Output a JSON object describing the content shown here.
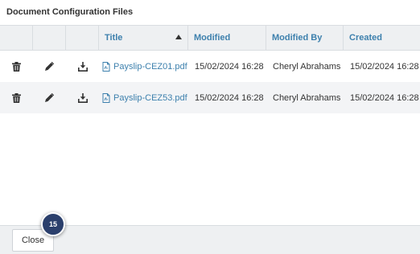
{
  "dialog": {
    "title": "Document Configuration Files",
    "close_label": "Close",
    "step_badge": "15"
  },
  "table": {
    "columns": [
      {
        "label": "",
        "kind": "delete-action"
      },
      {
        "label": "",
        "kind": "edit-action"
      },
      {
        "label": "",
        "kind": "download-action"
      },
      {
        "label": "Title",
        "sort": "ascending"
      },
      {
        "label": "Modified"
      },
      {
        "label": "Modified By"
      },
      {
        "label": "Created"
      }
    ],
    "rows": [
      {
        "title": "Payslip-CEZ01.pdf",
        "modified": "15/02/2024 16:28",
        "modified_by": "Cheryl Abrahams",
        "created": "15/02/2024 16:28"
      },
      {
        "title": "Payslip-CEZ53.pdf",
        "modified": "15/02/2024 16:28",
        "modified_by": "Cheryl Abrahams",
        "created": "15/02/2024 16:28"
      }
    ],
    "row_icons": [
      "trash-icon",
      "pencil-icon",
      "download-icon",
      "pdf-file-icon"
    ]
  },
  "colors": {
    "link": "#3d80ad",
    "header_bg": "#eef0f2",
    "alt_row_bg": "#f3f4f6",
    "badge_bg": "#2b3f6c"
  }
}
